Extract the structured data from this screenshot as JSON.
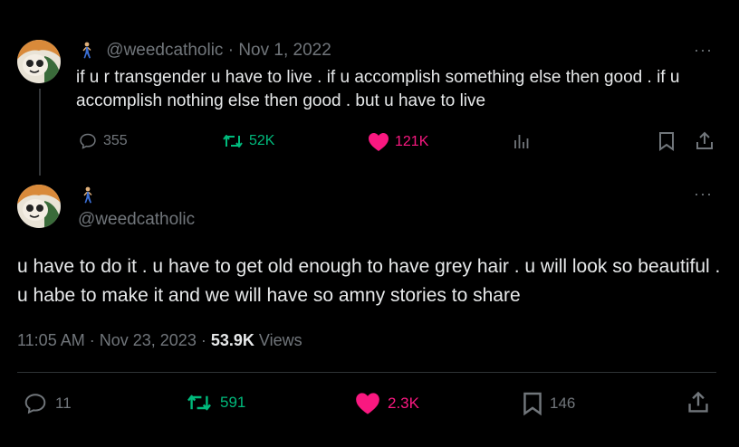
{
  "tweet1": {
    "handle": "@weedcatholic",
    "separator": "·",
    "date": "Nov 1, 2022",
    "more": "···",
    "text": "if u r transgender u have to live . if u accomplish something else then good . if u accomplish nothing else then good . but u have to live",
    "replies": "355",
    "retweets": "52K",
    "likes": "121K",
    "icons": [
      "walking-person-icon",
      "reply-icon",
      "retweet-icon",
      "heart-icon",
      "views-icon",
      "bookmark-icon",
      "share-icon"
    ]
  },
  "tweet2": {
    "handle": "@weedcatholic",
    "more": "···",
    "text": "u have to do it . u have to get old enough to have grey hair . u will look so beautiful . u habe to make it and we will have so amny stories to share",
    "time": "11:05 AM",
    "separator": "·",
    "date": "Nov 23, 2023",
    "separator2": "·",
    "views_count": "53.9K",
    "views_label": "Views",
    "replies": "11",
    "retweets": "591",
    "likes": "2.3K",
    "bookmarks": "146"
  },
  "colors": {
    "background": "#000000",
    "text": "#e7e9ea",
    "muted": "#71767b",
    "retweet": "#00ba7c",
    "like": "#f91880"
  }
}
